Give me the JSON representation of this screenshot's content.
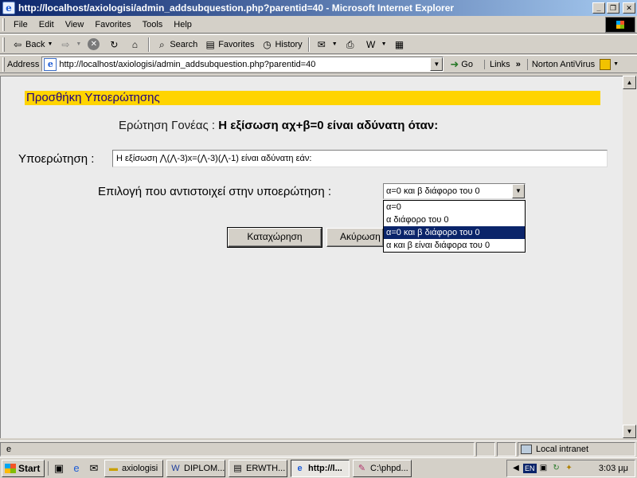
{
  "window": {
    "title": "http://localhost/axiologisi/admin_addsubquestion.php?parentid=40 - Microsoft Internet Explorer",
    "app_icon": "ie-page-icon"
  },
  "menu": [
    "File",
    "Edit",
    "View",
    "Favorites",
    "Tools",
    "Help"
  ],
  "toolbar": {
    "back": "Back",
    "search": "Search",
    "favorites": "Favorites",
    "history": "History"
  },
  "address": {
    "label": "Address",
    "url": "http://localhost/axiologisi/admin_addsubquestion.php?parentid=40",
    "go": "Go",
    "links": "Links",
    "norton": "Norton AntiVirus"
  },
  "page": {
    "header": "Προσθήκη Υποερώτησης",
    "parent_label": "Ερώτηση Γονέας :",
    "parent_value": "Η εξίσωση αχ+β=0 είναι αδύνατη όταν:",
    "sub_label": "Υποερώτηση :",
    "sub_value": "Η εξίσωση ⋀(⋀-3)x=(⋀-3)(⋀-1) είναι αδύνατη εάν:",
    "choice_label": "Επιλογή που αντιστοιχεί στην υποερώτηση :",
    "choice_selected": "α=0 και β διάφορο του 0",
    "options": [
      "α=0",
      "α διάφορο του 0",
      "α=0 και β διάφορο του 0",
      "α και β είναι διάφορα του 0"
    ],
    "selected_index": 2,
    "submit": "Καταχώρηση",
    "cancel": "Ακύρωση"
  },
  "status": {
    "zone": "Local intranet"
  },
  "taskbar": {
    "start": "Start",
    "tasks": [
      {
        "label": "axiologisi",
        "icon": "folder-icon"
      },
      {
        "label": "DIPLOM...",
        "icon": "word-icon"
      },
      {
        "label": "ERWTH...",
        "icon": "document-icon"
      },
      {
        "label": "http://l...",
        "icon": "ie-icon",
        "active": true
      },
      {
        "label": "C:\\phpd...",
        "icon": "pen-icon"
      }
    ],
    "lang": "EN",
    "clock": "3:03 μμ"
  },
  "colors": {
    "header_bg": "#ffd400",
    "header_text": "#1e0080",
    "titlebar": "#0a246a",
    "selection": "#0a246a"
  }
}
